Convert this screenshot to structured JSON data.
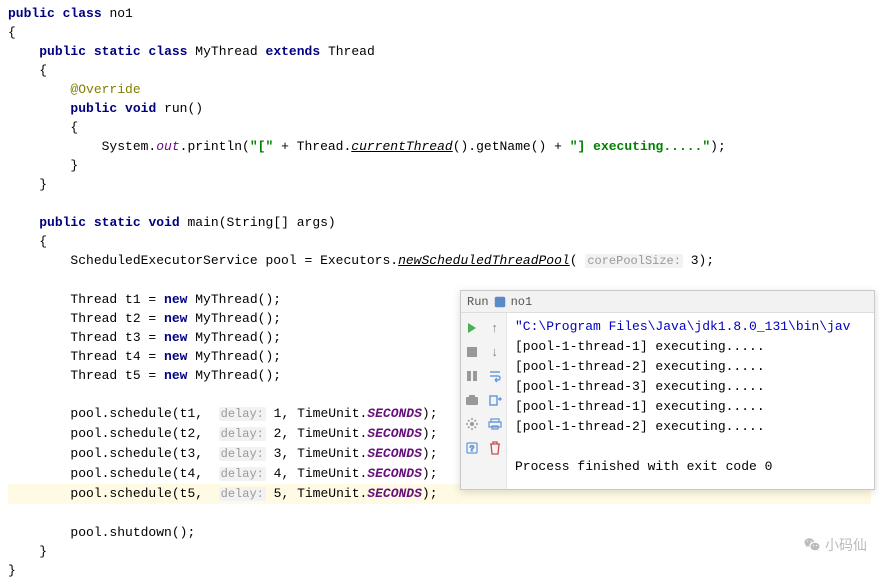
{
  "code": {
    "l1_kw1": "public",
    "l1_kw2": "class",
    "l1_cls": "no1",
    "l2": "{",
    "l3_kw1": "public",
    "l3_kw2": "static",
    "l3_kw3": "class",
    "l3_cls": "MyThread",
    "l3_kw4": "extends",
    "l3_sup": "Thread",
    "l4": "    {",
    "l5_ann": "@Override",
    "l6_kw1": "public",
    "l6_kw2": "void",
    "l6_m": "run()",
    "l7": "        {",
    "l8_a": "System.",
    "l8_out": "out",
    "l8_b": ".println(",
    "l8_s1": "\"[\"",
    "l8_c": " + Thread.",
    "l8_ct": "currentThread",
    "l8_d": "().getName() + ",
    "l8_s2": "\"] executing.....\"",
    "l8_e": ");",
    "l9": "        }",
    "l10": "    }",
    "l12_kw1": "public",
    "l12_kw2": "static",
    "l12_kw3": "void",
    "l12_m": "main(String[] args)",
    "l13": "    {",
    "l14_a": "ScheduledExecutorService pool = Executors.",
    "l14_m": "newScheduledThreadPool",
    "l14_b": "( ",
    "l14_hint": "corePoolSize:",
    "l14_c": " 3);",
    "l16_a": "Thread t1 = ",
    "l16_kw": "new",
    "l16_b": " MyThread();",
    "l17_a": "Thread t2 = ",
    "l17_kw": "new",
    "l17_b": " MyThread();",
    "l18_a": "Thread t3 = ",
    "l18_kw": "new",
    "l18_b": " MyThread();",
    "l19_a": "Thread t4 = ",
    "l19_kw": "new",
    "l19_b": " MyThread();",
    "l20_a": "Thread t5 = ",
    "l20_kw": "new",
    "l20_b": " MyThread();",
    "l22_a": "pool.schedule(t1,  ",
    "l22_hint": "delay:",
    "l22_b": " 1, TimeUnit.",
    "l22_e": "SECONDS",
    "l22_c": ");",
    "l23_a": "pool.schedule(t2,  ",
    "l23_hint": "delay:",
    "l23_b": " 2, TimeUnit.",
    "l23_e": "SECONDS",
    "l23_c": ");",
    "l24_a": "pool.schedule(t3,  ",
    "l24_hint": "delay:",
    "l24_b": " 3, TimeUnit.",
    "l24_e": "SECONDS",
    "l24_c": ");",
    "l25_a": "pool.schedule(t4,  ",
    "l25_hint": "delay:",
    "l25_b": " 4, TimeUnit.",
    "l25_e": "SECONDS",
    "l25_c": ");",
    "l26_a": "pool.schedule(t5,  ",
    "l26_hint": "delay:",
    "l26_b": " 5, TimeUnit.",
    "l26_e": "SECONDS",
    "l26_c": ");",
    "l28": "pool.shutdown();",
    "l29": "    }",
    "l30": "}"
  },
  "run": {
    "label": "Run",
    "title": "no1",
    "out1": "\"C:\\Program Files\\Java\\jdk1.8.0_131\\bin\\jav",
    "out2": "[pool-1-thread-1] executing.....",
    "out3": "[pool-1-thread-2] executing.....",
    "out4": "[pool-1-thread-3] executing.....",
    "out5": "[pool-1-thread-1] executing.....",
    "out6": "[pool-1-thread-2] executing.....",
    "out7": "Process finished with exit code 0"
  },
  "watermark": "小码仙"
}
